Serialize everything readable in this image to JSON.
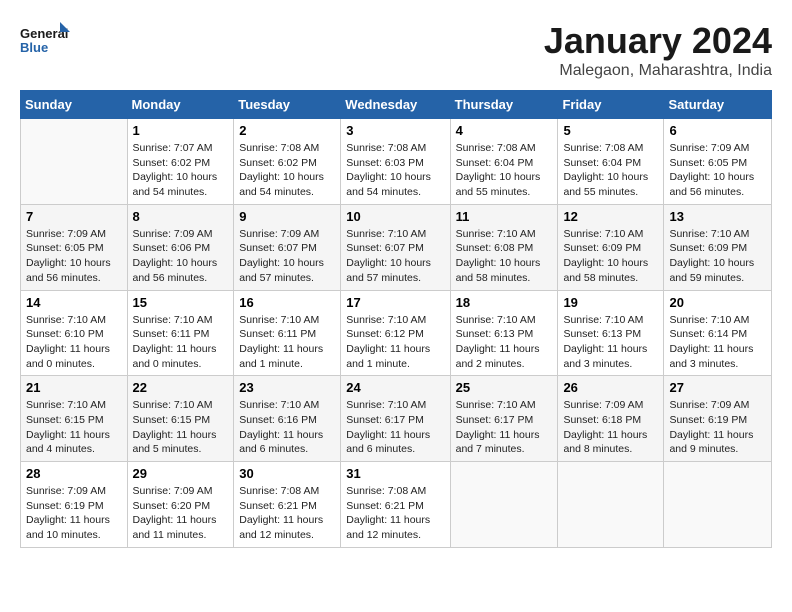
{
  "header": {
    "logo_line1": "General",
    "logo_line2": "Blue",
    "month": "January 2024",
    "location": "Malegaon, Maharashtra, India"
  },
  "days_of_week": [
    "Sunday",
    "Monday",
    "Tuesday",
    "Wednesday",
    "Thursday",
    "Friday",
    "Saturday"
  ],
  "weeks": [
    [
      {
        "num": "",
        "info": ""
      },
      {
        "num": "1",
        "info": "Sunrise: 7:07 AM\nSunset: 6:02 PM\nDaylight: 10 hours\nand 54 minutes."
      },
      {
        "num": "2",
        "info": "Sunrise: 7:08 AM\nSunset: 6:02 PM\nDaylight: 10 hours\nand 54 minutes."
      },
      {
        "num": "3",
        "info": "Sunrise: 7:08 AM\nSunset: 6:03 PM\nDaylight: 10 hours\nand 54 minutes."
      },
      {
        "num": "4",
        "info": "Sunrise: 7:08 AM\nSunset: 6:04 PM\nDaylight: 10 hours\nand 55 minutes."
      },
      {
        "num": "5",
        "info": "Sunrise: 7:08 AM\nSunset: 6:04 PM\nDaylight: 10 hours\nand 55 minutes."
      },
      {
        "num": "6",
        "info": "Sunrise: 7:09 AM\nSunset: 6:05 PM\nDaylight: 10 hours\nand 56 minutes."
      }
    ],
    [
      {
        "num": "7",
        "info": "Sunrise: 7:09 AM\nSunset: 6:05 PM\nDaylight: 10 hours\nand 56 minutes."
      },
      {
        "num": "8",
        "info": "Sunrise: 7:09 AM\nSunset: 6:06 PM\nDaylight: 10 hours\nand 56 minutes."
      },
      {
        "num": "9",
        "info": "Sunrise: 7:09 AM\nSunset: 6:07 PM\nDaylight: 10 hours\nand 57 minutes."
      },
      {
        "num": "10",
        "info": "Sunrise: 7:10 AM\nSunset: 6:07 PM\nDaylight: 10 hours\nand 57 minutes."
      },
      {
        "num": "11",
        "info": "Sunrise: 7:10 AM\nSunset: 6:08 PM\nDaylight: 10 hours\nand 58 minutes."
      },
      {
        "num": "12",
        "info": "Sunrise: 7:10 AM\nSunset: 6:09 PM\nDaylight: 10 hours\nand 58 minutes."
      },
      {
        "num": "13",
        "info": "Sunrise: 7:10 AM\nSunset: 6:09 PM\nDaylight: 10 hours\nand 59 minutes."
      }
    ],
    [
      {
        "num": "14",
        "info": "Sunrise: 7:10 AM\nSunset: 6:10 PM\nDaylight: 11 hours\nand 0 minutes."
      },
      {
        "num": "15",
        "info": "Sunrise: 7:10 AM\nSunset: 6:11 PM\nDaylight: 11 hours\nand 0 minutes."
      },
      {
        "num": "16",
        "info": "Sunrise: 7:10 AM\nSunset: 6:11 PM\nDaylight: 11 hours\nand 1 minute."
      },
      {
        "num": "17",
        "info": "Sunrise: 7:10 AM\nSunset: 6:12 PM\nDaylight: 11 hours\nand 1 minute."
      },
      {
        "num": "18",
        "info": "Sunrise: 7:10 AM\nSunset: 6:13 PM\nDaylight: 11 hours\nand 2 minutes."
      },
      {
        "num": "19",
        "info": "Sunrise: 7:10 AM\nSunset: 6:13 PM\nDaylight: 11 hours\nand 3 minutes."
      },
      {
        "num": "20",
        "info": "Sunrise: 7:10 AM\nSunset: 6:14 PM\nDaylight: 11 hours\nand 3 minutes."
      }
    ],
    [
      {
        "num": "21",
        "info": "Sunrise: 7:10 AM\nSunset: 6:15 PM\nDaylight: 11 hours\nand 4 minutes."
      },
      {
        "num": "22",
        "info": "Sunrise: 7:10 AM\nSunset: 6:15 PM\nDaylight: 11 hours\nand 5 minutes."
      },
      {
        "num": "23",
        "info": "Sunrise: 7:10 AM\nSunset: 6:16 PM\nDaylight: 11 hours\nand 6 minutes."
      },
      {
        "num": "24",
        "info": "Sunrise: 7:10 AM\nSunset: 6:17 PM\nDaylight: 11 hours\nand 6 minutes."
      },
      {
        "num": "25",
        "info": "Sunrise: 7:10 AM\nSunset: 6:17 PM\nDaylight: 11 hours\nand 7 minutes."
      },
      {
        "num": "26",
        "info": "Sunrise: 7:09 AM\nSunset: 6:18 PM\nDaylight: 11 hours\nand 8 minutes."
      },
      {
        "num": "27",
        "info": "Sunrise: 7:09 AM\nSunset: 6:19 PM\nDaylight: 11 hours\nand 9 minutes."
      }
    ],
    [
      {
        "num": "28",
        "info": "Sunrise: 7:09 AM\nSunset: 6:19 PM\nDaylight: 11 hours\nand 10 minutes."
      },
      {
        "num": "29",
        "info": "Sunrise: 7:09 AM\nSunset: 6:20 PM\nDaylight: 11 hours\nand 11 minutes."
      },
      {
        "num": "30",
        "info": "Sunrise: 7:08 AM\nSunset: 6:21 PM\nDaylight: 11 hours\nand 12 minutes."
      },
      {
        "num": "31",
        "info": "Sunrise: 7:08 AM\nSunset: 6:21 PM\nDaylight: 11 hours\nand 12 minutes."
      },
      {
        "num": "",
        "info": ""
      },
      {
        "num": "",
        "info": ""
      },
      {
        "num": "",
        "info": ""
      }
    ]
  ]
}
